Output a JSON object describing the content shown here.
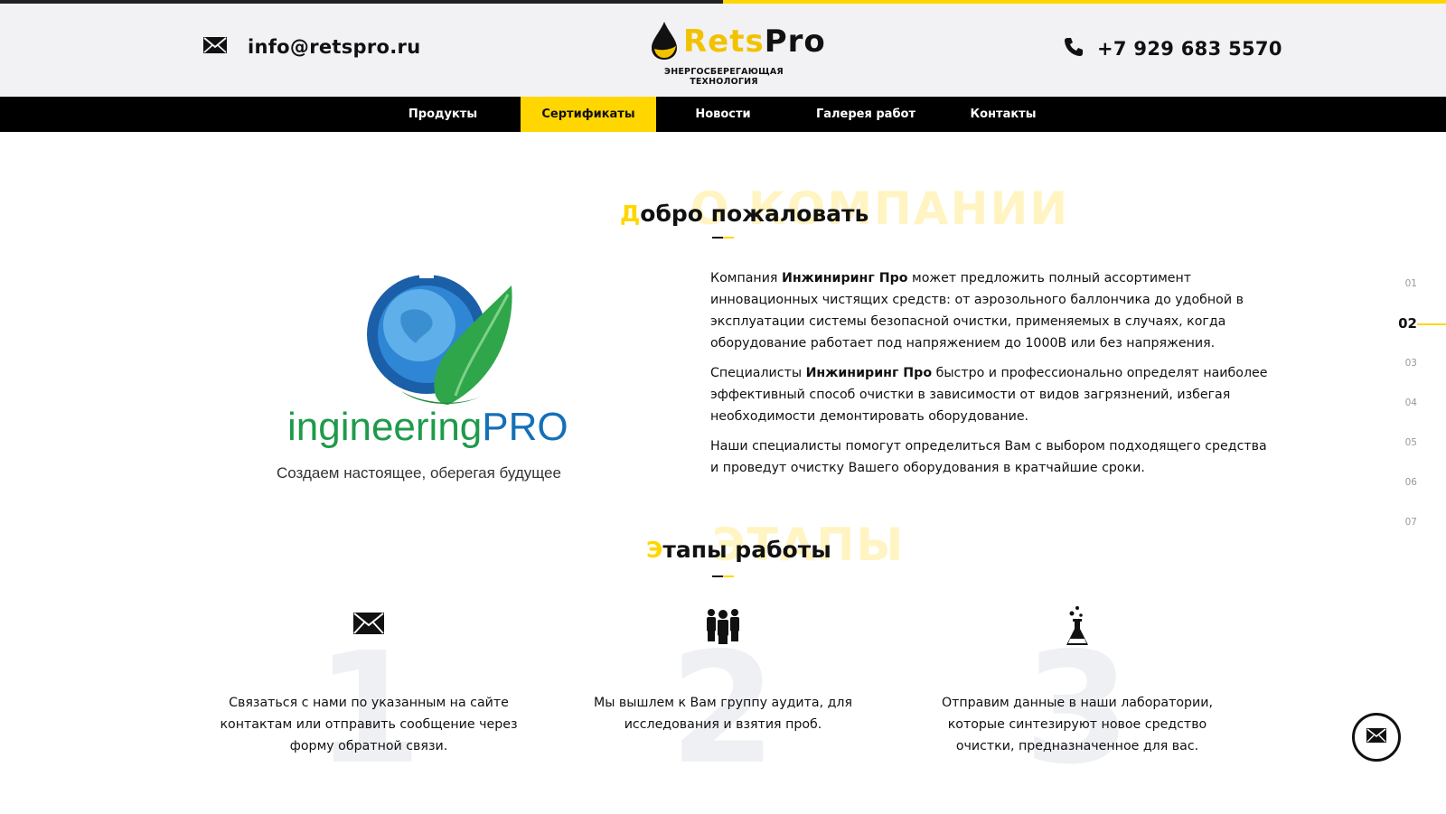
{
  "header": {
    "email": "info@retspro.ru",
    "phone": "+7 929 683 5570",
    "logo_part1": "Rets",
    "logo_part2": "Pro",
    "logo_tagline": "ЭНЕРГОСБЕРЕГАЮЩАЯ ТЕХНОЛОГИЯ"
  },
  "nav": {
    "items": [
      {
        "label": "Продукты"
      },
      {
        "label": "Сертификаты",
        "active": true
      },
      {
        "label": "Новости"
      },
      {
        "label": "Галерея работ"
      },
      {
        "label": "Контакты"
      }
    ]
  },
  "about": {
    "ghost": "О КОМПАНИИ",
    "heading_first": "Д",
    "heading_rest": "обро пожаловать",
    "logo_word_1": "ingineering",
    "logo_word_2": "PRO",
    "logo_slogan": "Создаем настоящее, оберегая будущее",
    "p1_a": "Компания ",
    "p1_bold": "Инжиниринг Про",
    "p1_b": " может предложить полный ассортимент инновационных чистящих средств: от аэрозольного баллончика до удобной в эксплуатации системы безопасной очистки, применяемых в случаях, когда оборудование работает под напряжением до 1000В или без напряжения.",
    "p2_a": "Специалисты ",
    "p2_bold": "Инжиниринг Про",
    "p2_b": " быстро и профессионально определят наиболее эффективный способ очистки в зависимости от видов загрязнений, избегая необходимости демонтировать оборудование.",
    "p3": "Наши специалисты помогут определиться Вам с выбором подходящего средства и проведут очистку Вашего оборудования в кратчайшие сроки."
  },
  "side_nav": [
    "01",
    "02",
    "03",
    "04",
    "05",
    "06",
    "07"
  ],
  "side_nav_active": "02",
  "stages": {
    "ghost": "ЭТАПЫ",
    "heading_first": "Э",
    "heading_rest": "тапы работы",
    "steps": [
      {
        "num": "1",
        "icon": "envelope-icon",
        "text": "Связаться с нами по указанным на сайте контактам или отправить сообщение через форму обратной связи."
      },
      {
        "num": "2",
        "icon": "team-icon",
        "text": "Мы вышлем к Вам группу аудита, для исследования и взятия проб."
      },
      {
        "num": "3",
        "icon": "flask-icon",
        "text": "Отправим данные в наши лаборатории, которые синтезируют новое средство очистки, предназначенное для вас."
      }
    ]
  },
  "colors": {
    "accent": "#ffd600",
    "nav_bg": "#000000",
    "header_bg": "#f2f2f4"
  }
}
